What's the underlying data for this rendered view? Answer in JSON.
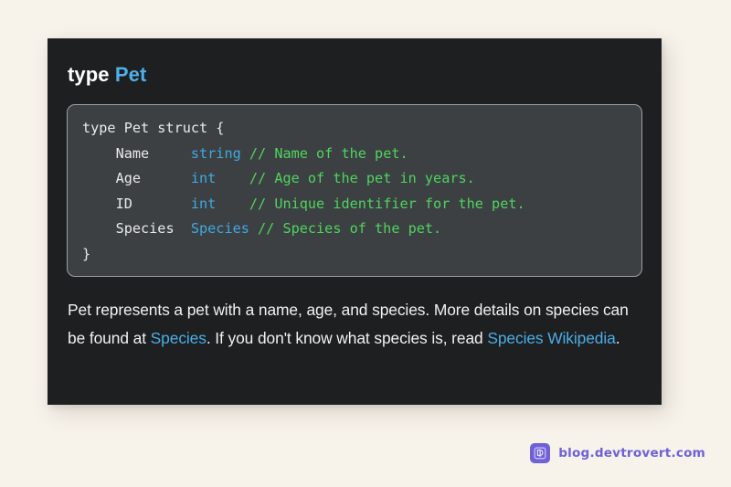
{
  "theme": {
    "page_background": "#f7f2ea",
    "card_background": "#1d1f21",
    "code_background": "#3d4043",
    "code_border": "#9aa0a4",
    "accent_blue": "#4fb0e8",
    "code_type_blue": "#3fa9e0",
    "comment_green": "#4ed45e",
    "text_white": "#f0f1f2",
    "brand_purple": "#6f61d8"
  },
  "card": {
    "heading": {
      "keyword": "type",
      "type_name": "Pet"
    },
    "code": {
      "language": "go",
      "lines": [
        {
          "indent": 0,
          "tokens": [
            {
              "text": "type Pet struct {",
              "kind": "plain"
            }
          ]
        },
        {
          "indent": 1,
          "field": "Name",
          "field_pad": "Name     ",
          "type": "string",
          "type_pad": "string ",
          "comment": "// Name of the pet."
        },
        {
          "indent": 1,
          "field": "Age",
          "field_pad": "Age      ",
          "type": "int",
          "type_pad": "int    ",
          "comment": "// Age of the pet in years."
        },
        {
          "indent": 1,
          "field": "ID",
          "field_pad": "ID       ",
          "type": "int",
          "type_pad": "int    ",
          "comment": "// Unique identifier for the pet."
        },
        {
          "indent": 1,
          "field": "Species",
          "field_pad": "Species  ",
          "type": "Species",
          "type_pad": "Species ",
          "comment": "// Species of the pet."
        },
        {
          "indent": 0,
          "tokens": [
            {
              "text": "}",
              "kind": "plain"
            }
          ]
        }
      ],
      "rendered": {
        "line1": "type Pet struct {",
        "line2_indent": "    ",
        "line2_field": "Name     ",
        "line2_type": "string ",
        "line2_comment": "// Name of the pet.",
        "line3_indent": "    ",
        "line3_field": "Age      ",
        "line3_type": "int    ",
        "line3_comment": "// Age of the pet in years.",
        "line4_indent": "    ",
        "line4_field": "ID       ",
        "line4_type": "int    ",
        "line4_comment": "// Unique identifier for the pet.",
        "line5_indent": "    ",
        "line5_field": "Species  ",
        "line5_type": "Species ",
        "line5_comment": "// Species of the pet.",
        "line6": "}"
      }
    },
    "description": {
      "segment_1": "Pet represents a pet with a name, age, and species. More details on species can be found at ",
      "link_1": "Species",
      "segment_2": ". If you don't know what species is, read ",
      "link_2": "Species Wikipedia",
      "segment_3": "."
    }
  },
  "watermark": {
    "logo_icon": "devtrovert-logo-icon",
    "text": "blog.devtrovert.com"
  }
}
